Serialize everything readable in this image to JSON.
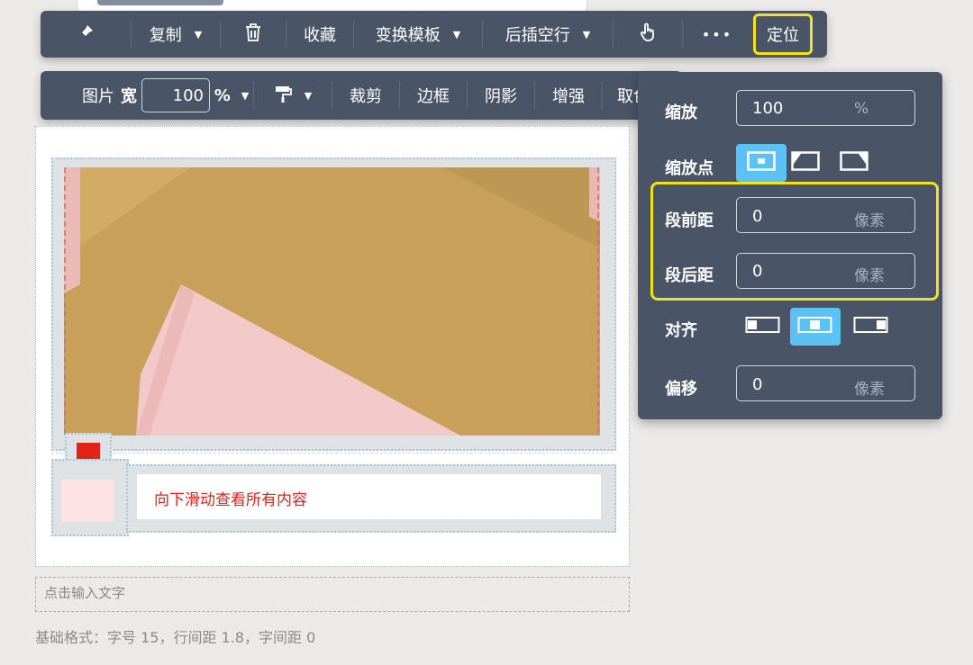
{
  "toolbar1": {
    "copy_label": "复制",
    "favorite_label": "收藏",
    "template_label": "变换模板",
    "insert_empty_label": "后插空行",
    "more_label": "•••",
    "position_label": "定位"
  },
  "toolbar2": {
    "image_label": "图片",
    "width_label": "宽",
    "width_value": "100",
    "width_unit": "%",
    "crop_label": "裁剪",
    "border_label": "边框",
    "shadow_label": "阴影",
    "enhance_label": "增强",
    "color_label": "取色"
  },
  "editor": {
    "scroll_hint": "向下滑动查看所有内容",
    "text_input_placeholder": "点击输入文字",
    "format_info": "基础格式：字号 15，行间距 1.8，字间距 0"
  },
  "panel": {
    "scale_label": "缩放",
    "scale_value": "100",
    "scale_unit": "%",
    "scale_point_label": "缩放点",
    "space_before_label": "段前距",
    "space_before_value": "0",
    "space_before_unit": "像素",
    "space_after_label": "段后距",
    "space_after_value": "0",
    "space_after_unit": "像素",
    "align_label": "对齐",
    "offset_label": "偏移",
    "offset_value": "0",
    "offset_unit": "像素"
  },
  "colors": {
    "toolbar_bg": "#495466",
    "highlight": "#f2e21b",
    "active_button": "#5cc1f4",
    "hint_text": "#d8241c"
  }
}
